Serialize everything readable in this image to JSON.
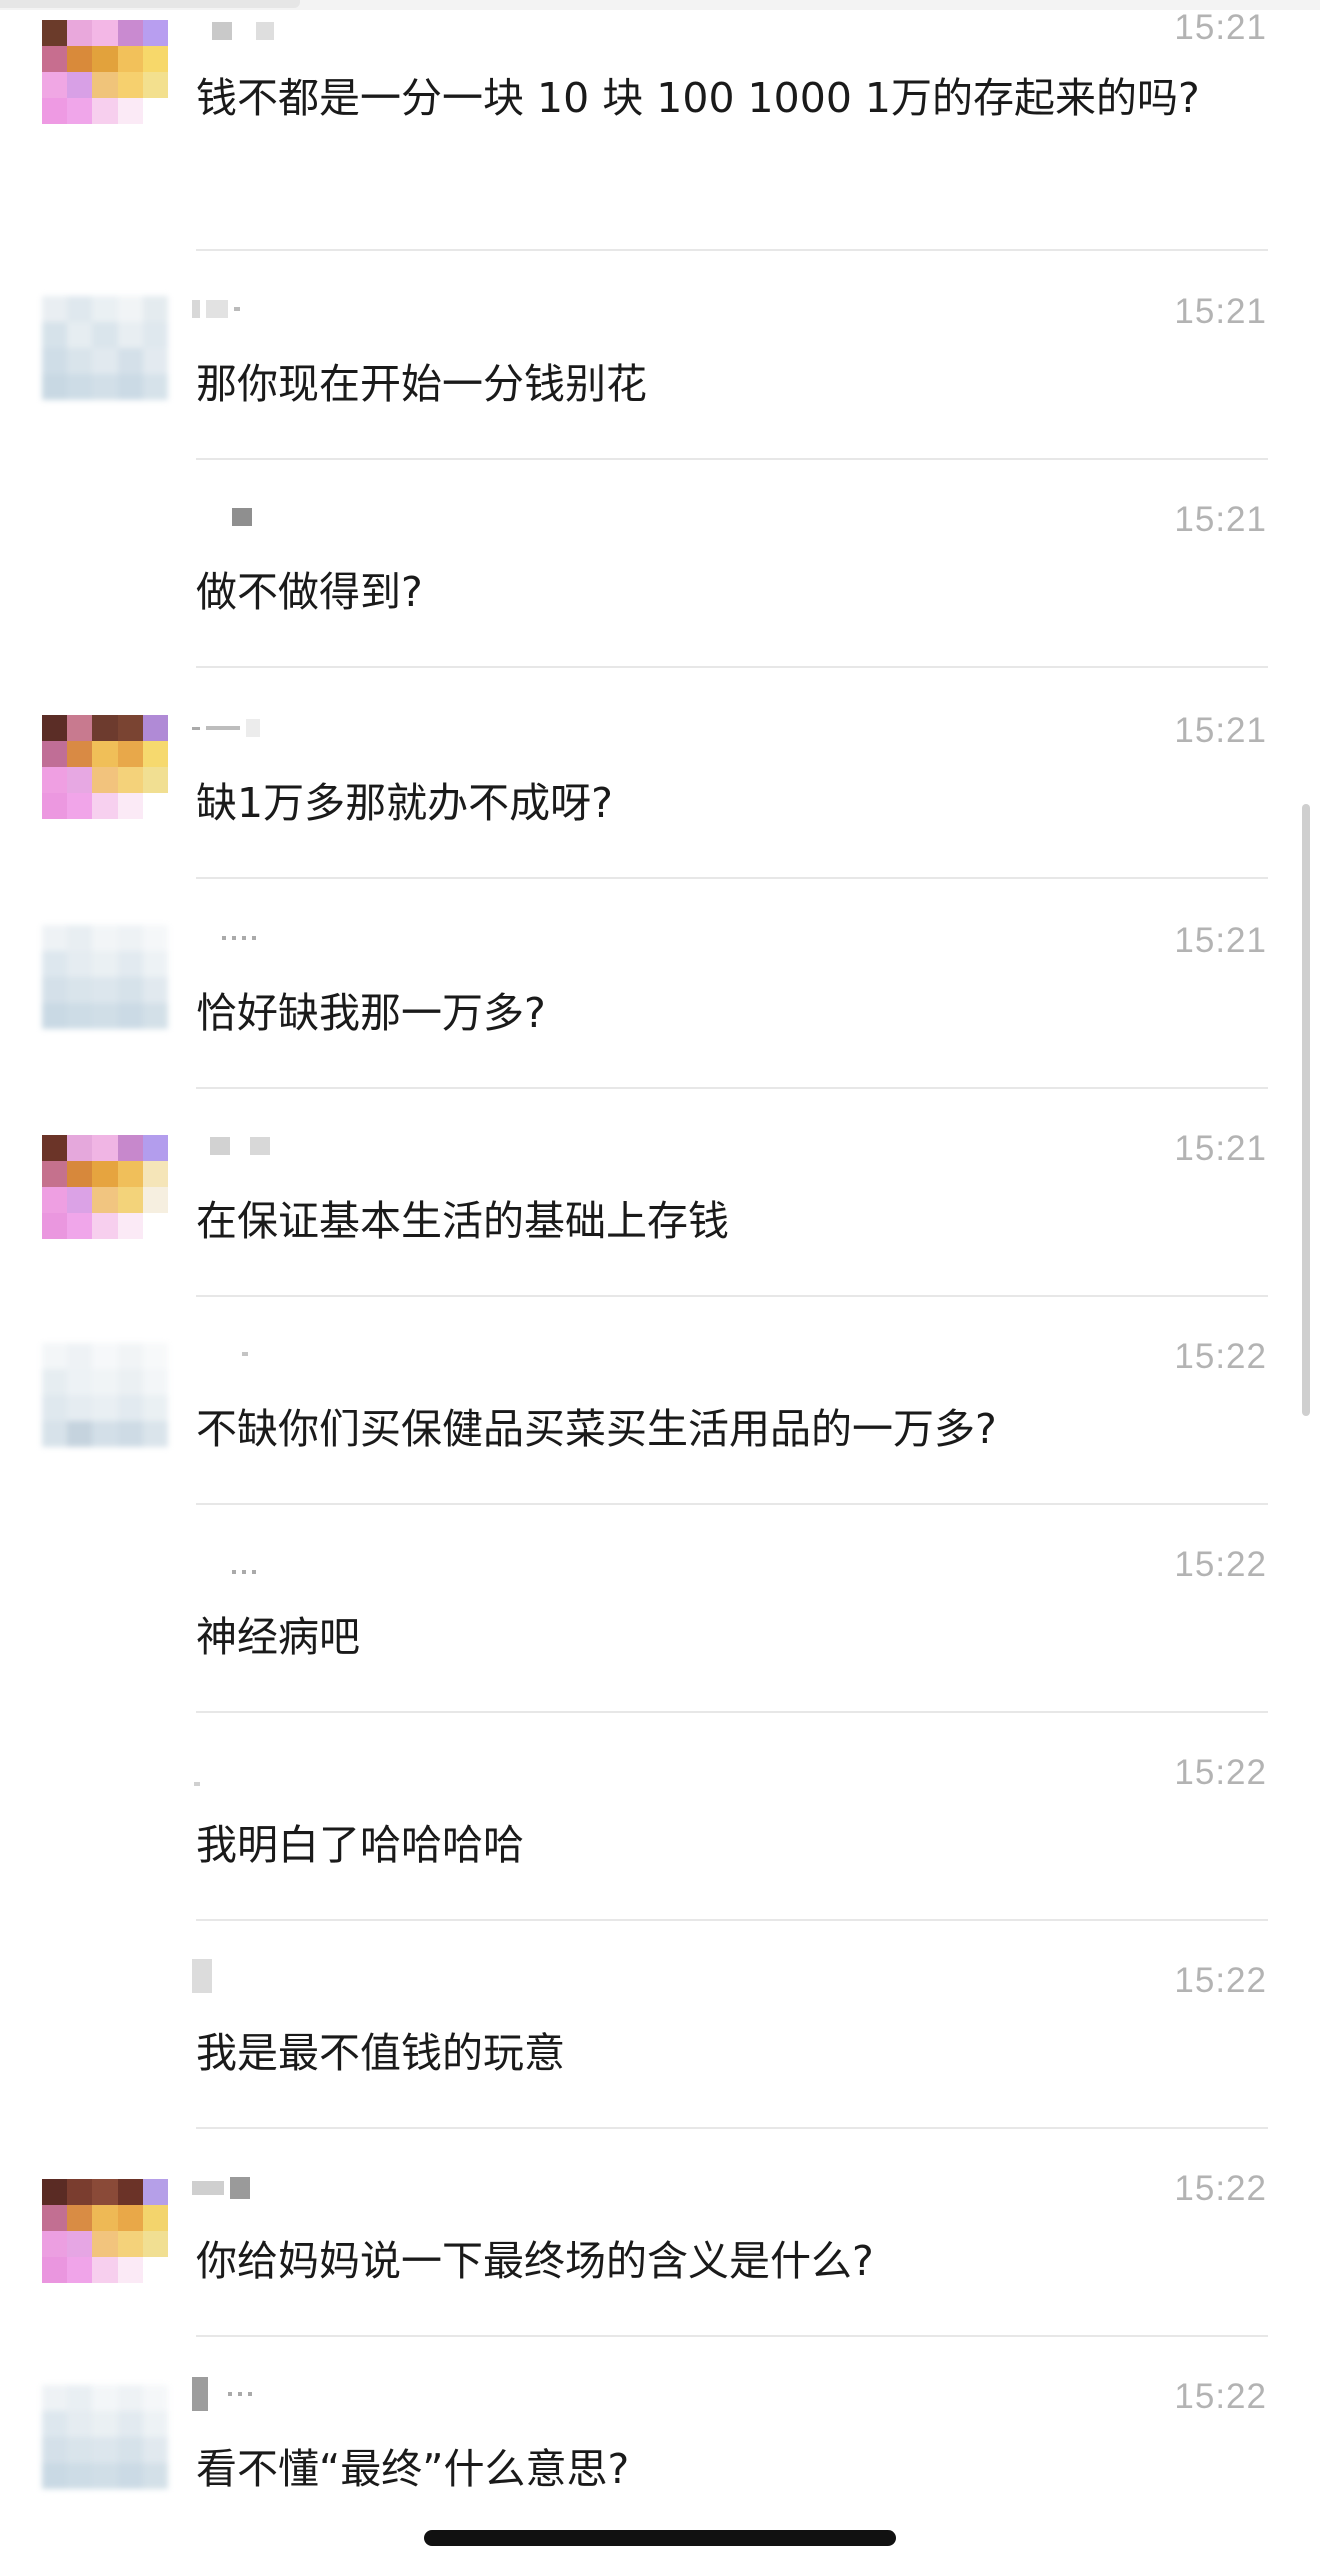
{
  "messages": [
    {
      "time": "15:21",
      "text": "钱不都是一分一块 10 块 100 1000 1万的存起来的吗?",
      "avatar": "mosaic-warm"
    },
    {
      "time": "15:21",
      "text": "那你现在开始一分钱别花",
      "avatar": "pale"
    },
    {
      "time": "15:21",
      "text": "做不做得到?",
      "avatar": "none"
    },
    {
      "time": "15:21",
      "text": "缺1万多那就办不成呀?",
      "avatar": "mosaic-warm"
    },
    {
      "time": "15:21",
      "text": "恰好缺我那一万多?",
      "avatar": "pale"
    },
    {
      "time": "15:21",
      "text": "在保证基本生活的基础上存钱",
      "avatar": "mosaic-warm"
    },
    {
      "time": "15:22",
      "text": "不缺你们买保健品买菜买生活用品的一万多?",
      "avatar": "pale"
    },
    {
      "time": "15:22",
      "text": "神经病吧",
      "avatar": "none"
    },
    {
      "time": "15:22",
      "text": "我明白了哈哈哈哈",
      "avatar": "none"
    },
    {
      "time": "15:22",
      "text": "我是最不值钱的玩意",
      "avatar": "none"
    },
    {
      "time": "15:22",
      "text": "你给妈妈说一下最终场的含义是什么?",
      "avatar": "mosaic-warm"
    },
    {
      "time": "15:22",
      "text": "看不懂“最终”什么意思?",
      "avatar": "pale"
    }
  ],
  "colors": {
    "text": "#1a1a1a",
    "time": "#b3b3b3",
    "divider": "#e7e7e7"
  }
}
